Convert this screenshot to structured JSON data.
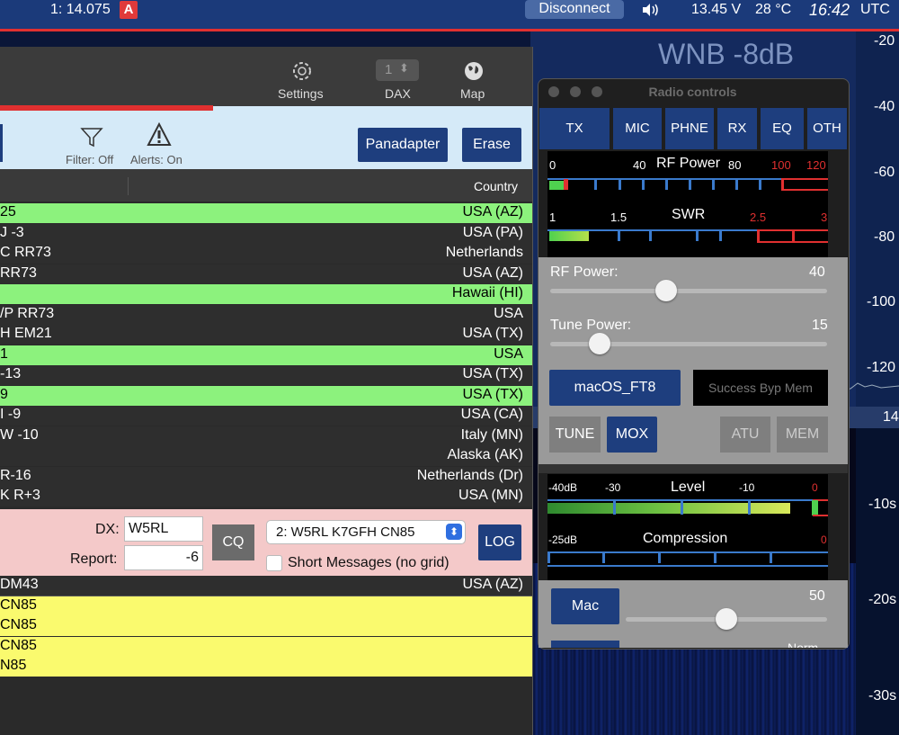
{
  "topbar": {
    "slice": "1: 14.075",
    "slice_badge": "A",
    "disconnect": "Disconnect",
    "speaker_icon": "speaker-icon",
    "voltage": "13.45 V",
    "temp": "28 °C",
    "time": "16:42",
    "tz": "UTC"
  },
  "panadapter": {
    "wnb": "WNB -8dB",
    "scale": [
      "-20",
      "-40",
      "-60",
      "-80",
      "-100",
      "-120"
    ],
    "freq": "14",
    "waterfall_scale": [
      "-10s",
      "-20s",
      "-30s"
    ]
  },
  "toolbar": {
    "settings": "Settings",
    "dax": "DAX",
    "dax_value": "1",
    "map": "Map"
  },
  "strip": {
    "filter": "Filter: Off",
    "alerts": "Alerts: On",
    "panadapter": "Panadapter",
    "erase": "Erase"
  },
  "list": {
    "country_header": "Country",
    "rows": [
      {
        "msg": "25",
        "country": "USA (AZ)",
        "style": "green"
      },
      {
        "msg": "J -3",
        "country": "USA (PA)",
        "style": "dark"
      },
      {
        "msg": "C RR73",
        "country": "Netherlands",
        "style": "dark"
      },
      {
        "msg": "RR73",
        "country": "USA (AZ)",
        "style": "dark"
      },
      {
        "msg": "",
        "country": "Hawaii (HI)",
        "style": "green"
      },
      {
        "msg": "/P RR73",
        "country": "USA",
        "style": "dark"
      },
      {
        "msg": "H EM21",
        "country": "USA (TX)",
        "style": "dark"
      },
      {
        "msg": "1",
        "country": "USA",
        "style": "green"
      },
      {
        "msg": "-13",
        "country": "USA (TX)",
        "style": "dark"
      },
      {
        "msg": "9",
        "country": "USA (TX)",
        "style": "green"
      },
      {
        "msg": "I -9",
        "country": "USA (CA)",
        "style": "dark"
      },
      {
        "msg": "W -10",
        "country": "Italy (MN)",
        "style": "dark"
      },
      {
        "msg": "",
        "country": "Alaska (AK)",
        "style": "dark"
      },
      {
        "msg": "R-16",
        "country": "Netherlands (Dr)",
        "style": "dark"
      },
      {
        "msg": "K R+3",
        "country": "USA (MN)",
        "style": "dark"
      }
    ]
  },
  "entry": {
    "dx_label": "DX:",
    "dx_value": "W5RL",
    "report_label": "Report:",
    "report_value": "-6",
    "cq": "CQ",
    "message_select": "2: W5RL K7GFH CN85",
    "short_messages": "Short Messages (no grid)",
    "log": "LOG"
  },
  "qso": {
    "rows": [
      {
        "msg": "DM43",
        "country": "USA (AZ)",
        "style": "dark"
      },
      {
        "msg": " CN85",
        "country": "",
        "style": "yellow"
      },
      {
        "msg": " CN85",
        "country": "",
        "style": "yellow"
      },
      {
        "msg": " CN85",
        "country": "",
        "style": "yellow"
      },
      {
        "msg": "N85",
        "country": "",
        "style": "yellow"
      }
    ]
  },
  "radio": {
    "title": "Radio controls",
    "tabs": [
      "TX",
      "MIC",
      "PHNE",
      "RX",
      "EQ",
      "OTH"
    ],
    "meter1": {
      "rf_label": "RF Power",
      "rf_ticks": [
        "0",
        "40",
        "80",
        "100",
        "120"
      ],
      "swr_label": "SWR",
      "swr_ticks": [
        "1",
        "1.5",
        "2.5",
        "3"
      ]
    },
    "rf_power_label": "RF Power:",
    "rf_power_value": "40",
    "rf_power_level": 0.42,
    "tune_power_label": "Tune Power:",
    "tune_power_value": "15",
    "tune_power_level": 0.18,
    "profile": "macOS_FT8",
    "status": "Success Byp Mem",
    "tune": "TUNE",
    "mox": "MOX",
    "atu": "ATU",
    "mem": "MEM",
    "meter2": {
      "level_label": "Level",
      "level_ticks": [
        "-40dB",
        "-30",
        "-10",
        "0"
      ],
      "comp_label": "Compression",
      "comp_ticks": [
        "-25dB",
        "0"
      ]
    },
    "mic_source": "Mac",
    "mic_value": "50",
    "mic_level": 0.5,
    "bottom_partial": "Norm"
  },
  "colors": {
    "accent_blue": "#1e3e7e",
    "highlight_green": "#8cf27d",
    "highlight_yellow": "#fafa6e",
    "alert_red": "#e03030"
  }
}
